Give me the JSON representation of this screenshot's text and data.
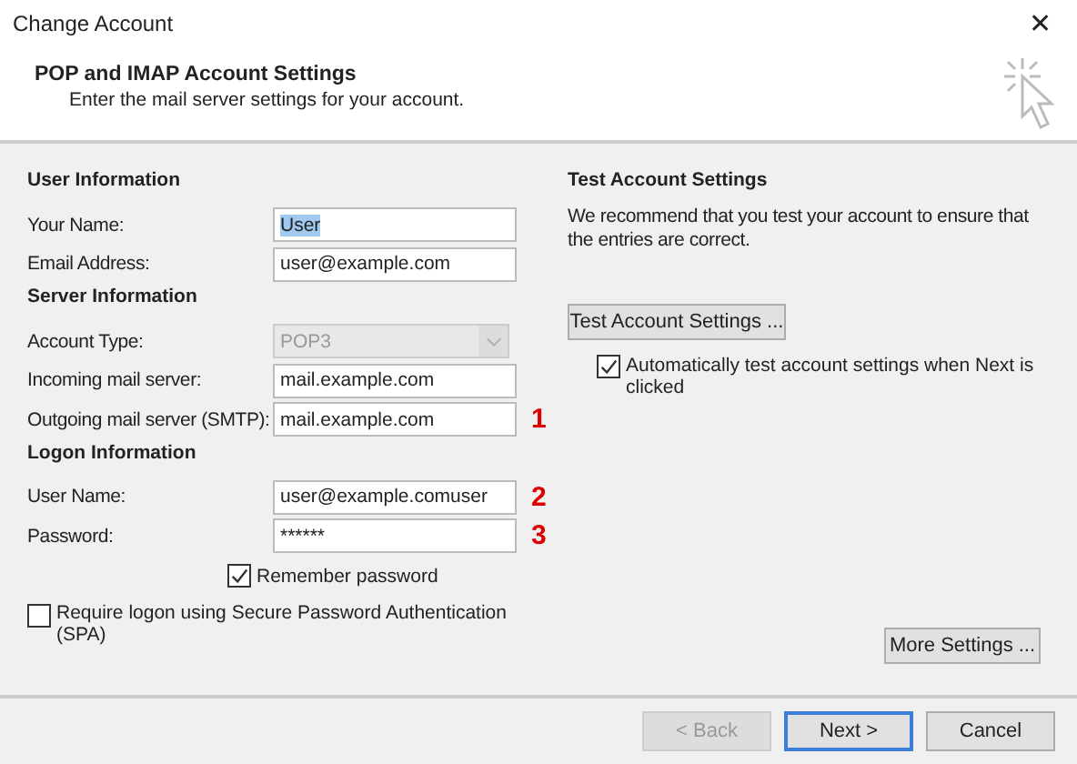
{
  "window": {
    "title": "Change Account",
    "close": "✕"
  },
  "header": {
    "title": "POP and IMAP Account Settings",
    "subtitle": "Enter the mail server settings for your account."
  },
  "left": {
    "sections": [
      {
        "heading": "User Information",
        "rows": [
          {
            "kind": "text",
            "label": "Your Name:",
            "value": "User",
            "selected": true
          },
          {
            "kind": "text",
            "label": "Email Address:",
            "value": "user@example.com",
            "selected": false
          }
        ]
      },
      {
        "heading": "Server Information",
        "rows": [
          {
            "kind": "select",
            "label": "Account Type:",
            "value": "POP3",
            "disabled": true
          },
          {
            "kind": "text",
            "label": "Incoming mail server:",
            "value": "mail.example.com",
            "selected": false
          },
          {
            "kind": "text",
            "label": "Outgoing mail server (SMTP):",
            "value": "mail.example.com",
            "selected": false,
            "annotation": "1"
          }
        ]
      },
      {
        "heading": "Logon Information",
        "rows": [
          {
            "kind": "text",
            "label": "User Name:",
            "value": "user@example.comuser",
            "selected": false,
            "annotation": "2"
          },
          {
            "kind": "text",
            "label": "Password:",
            "value": "******",
            "selected": false,
            "annotation": "3"
          }
        ]
      }
    ],
    "remember": {
      "label": "Remember password",
      "checked": true
    },
    "spa": {
      "label": "Require logon using Secure Password Authentication (SPA)",
      "checked": false
    }
  },
  "right": {
    "heading": "Test Account Settings",
    "description": "We recommend that you test your account to ensure that the entries are correct.",
    "test_button": "Test Account Settings ...",
    "auto_test": {
      "label": "Automatically test account settings when Next is clicked",
      "checked": true
    },
    "more_button": "More Settings ..."
  },
  "footer": {
    "buttons": [
      {
        "label": "< Back",
        "disabled": true,
        "default": false
      },
      {
        "label": "Next >",
        "disabled": false,
        "default": true
      },
      {
        "label": "Cancel",
        "disabled": false,
        "default": false
      }
    ]
  }
}
